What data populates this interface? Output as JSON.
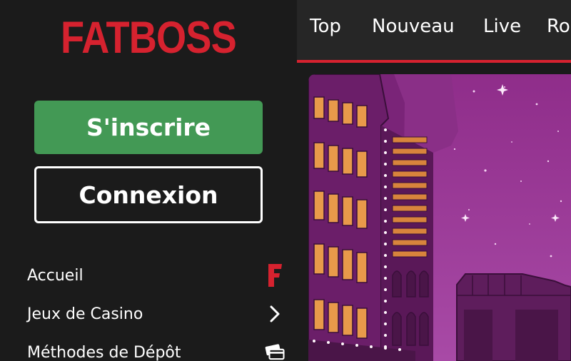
{
  "brand": {
    "logo_text": "FATBOSS",
    "accent_color": "#d6222f",
    "signup_color": "#439955"
  },
  "auth": {
    "signup_label": "S'inscrire",
    "login_label": "Connexion"
  },
  "sidebar": {
    "items": [
      {
        "label": "Accueil",
        "icon": "fatboss-f-icon"
      },
      {
        "label": "Jeux de Casino",
        "icon": "chevron-right-icon"
      },
      {
        "label": "Méthodes de Dépôt",
        "icon": "credit-card-icon"
      }
    ]
  },
  "nav": {
    "tabs": [
      {
        "label": "Top"
      },
      {
        "label": "Nouveau"
      },
      {
        "label": "Live"
      },
      {
        "label": "Ro"
      }
    ]
  },
  "hero": {
    "image": "casino-building-illustration"
  }
}
